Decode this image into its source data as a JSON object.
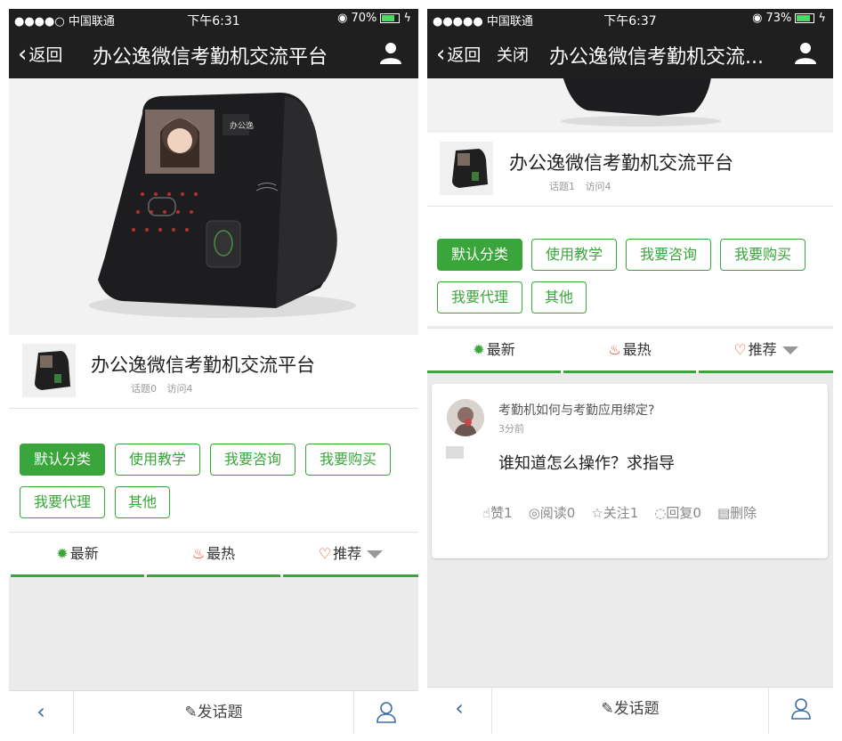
{
  "screens": [
    {
      "status": {
        "carrier": "●●●●○ 中国联通",
        "time": "下午6:31",
        "battery": "70%",
        "battery_level": 0.7
      },
      "nav": {
        "back": "返回",
        "title": "办公逸微信考勤机交流平台"
      },
      "forum": {
        "name": "办公逸微信考勤机交流平台",
        "topics": "话题0",
        "visits": "访问4"
      },
      "categories": [
        "默认分类",
        "使用教学",
        "我要咨询",
        "我要购买",
        "我要代理",
        "其他"
      ],
      "tabs": {
        "latest": "最新",
        "hot": "最热",
        "recommend": "推荐"
      },
      "bottom": {
        "post": "发话题"
      }
    },
    {
      "status": {
        "carrier": "●●●●● 中国联通",
        "time": "下午6:37",
        "battery": "73%",
        "battery_level": 0.73
      },
      "nav": {
        "back": "返回",
        "close": "关闭",
        "title": "办公逸微信考勤机交流..."
      },
      "forum": {
        "name": "办公逸微信考勤机交流平台",
        "topics": "话题1",
        "visits": "访问4"
      },
      "categories": [
        "默认分类",
        "使用教学",
        "我要咨询",
        "我要购买",
        "我要代理",
        "其他"
      ],
      "tabs": {
        "latest": "最新",
        "hot": "最热",
        "recommend": "推荐"
      },
      "post": {
        "title": "考勤机如何与考勤应用绑定?",
        "time": "3分前",
        "body": "谁知道怎么操作？求指导",
        "like": "赞1",
        "read": "阅读0",
        "follow": "关注1",
        "reply": "回复0",
        "delete": "删除"
      },
      "bottom": {
        "post": "发话题"
      }
    }
  ],
  "colors": {
    "accent": "#3aa53a",
    "bar": "#1f1f1f"
  },
  "icons": [
    "wifi-icon",
    "alarm-icon",
    "battery-icon",
    "chevron-left-icon",
    "user-icon",
    "gear-icon",
    "flame-icon",
    "heart-icon",
    "pencil-icon",
    "thumb-up-icon",
    "eye-icon",
    "star-icon",
    "comment-icon",
    "trash-icon"
  ]
}
